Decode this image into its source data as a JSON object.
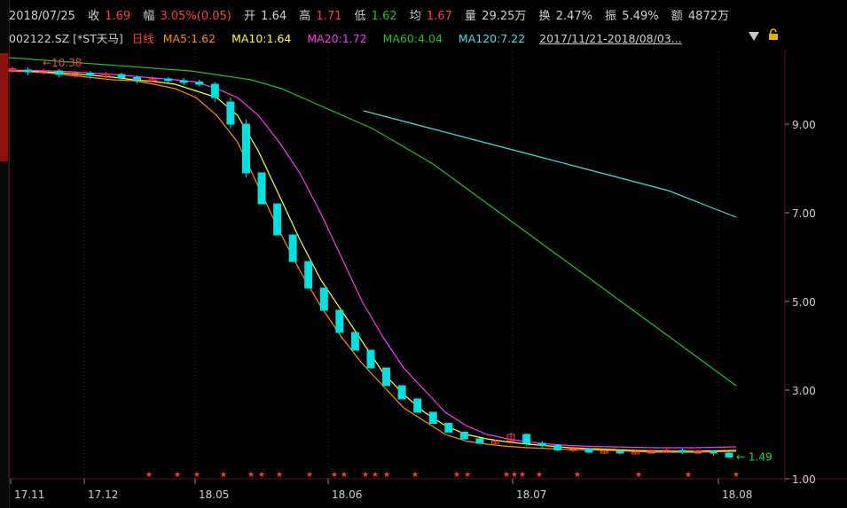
{
  "quote": {
    "date": "2018/07/25",
    "close_label": "收",
    "close": "1.69",
    "change_label": "幅",
    "change": "3.05%(0.05)",
    "open_label": "开",
    "open": "1.64",
    "high_label": "高",
    "high": "1.71",
    "low_label": "低",
    "low": "1.62",
    "avg_label": "均",
    "avg": "1.67",
    "volume_label": "量",
    "volume": "29.25万",
    "turnover_label": "换",
    "turnover": "2.47%",
    "amplitude_label": "振",
    "amplitude": "5.49%",
    "amount_label": "额",
    "amount": "4872万"
  },
  "indicators": {
    "code": "002122.SZ [*ST天马]",
    "period": "日线",
    "ma5": "MA5:1.62",
    "ma10": "MA10:1.64",
    "ma20": "MA20:1.72",
    "ma60": "MA60:4.04",
    "ma120": "MA120:7.22",
    "range": "2017/11/21-2018/08/03...",
    "dropdown_icon": "triangle-down-icon",
    "lock_icon": "unlock-icon"
  },
  "colors": {
    "up": "#ff3b3b",
    "down": "#00e0e0",
    "ma5": "#ff8c00",
    "ma10": "#ffff33",
    "ma20": "#ff33ff",
    "ma60": "#20c020",
    "ma120": "#40e0e0",
    "grid": "#6e0f0f"
  },
  "chart_data": {
    "type": "candlestick",
    "ylim": [
      1.0,
      10.7
    ],
    "y_ticks": [
      "9.00",
      "7.00",
      "5.00",
      "3.00",
      "1.00"
    ],
    "x_ticks": [
      "17.11",
      "17.12",
      "18.05",
      "18.06",
      "18.07",
      "18.08"
    ],
    "high_marker": "10.38",
    "last_marker": "1.49",
    "star_marker": "★",
    "ma5": [
      10.2,
      10.18,
      10.15,
      10.1,
      10.05,
      10.0,
      9.98,
      9.9,
      9.8,
      9.6,
      9.2,
      8.6,
      7.6,
      6.6,
      5.7,
      4.9,
      4.2,
      3.6,
      3.1,
      2.6,
      2.3,
      2.0,
      1.85,
      1.78,
      1.73,
      1.7,
      1.68,
      1.66,
      1.65,
      1.64,
      1.62,
      1.6,
      1.6,
      1.6,
      1.61,
      1.62
    ],
    "ma10": [
      10.2,
      10.19,
      10.17,
      10.14,
      10.1,
      10.06,
      10.0,
      9.96,
      9.9,
      9.75,
      9.6,
      9.2,
      8.4,
      7.4,
      6.4,
      5.5,
      4.8,
      4.1,
      3.4,
      2.9,
      2.5,
      2.2,
      2.0,
      1.9,
      1.83,
      1.78,
      1.74,
      1.7,
      1.68,
      1.66,
      1.64,
      1.63,
      1.62,
      1.62,
      1.63,
      1.64
    ],
    "ma20": [
      10.22,
      10.21,
      10.2,
      10.18,
      10.15,
      10.12,
      10.08,
      10.04,
      10.0,
      9.95,
      9.8,
      9.6,
      9.2,
      8.6,
      7.9,
      7.0,
      6.0,
      5.0,
      4.2,
      3.5,
      3.0,
      2.5,
      2.2,
      2.0,
      1.9,
      1.83,
      1.78,
      1.75,
      1.73,
      1.72,
      1.71,
      1.7,
      1.7,
      1.7,
      1.71,
      1.72
    ],
    "ma60": [
      10.5,
      10.45,
      10.4,
      10.35,
      10.3,
      10.25,
      10.2,
      10.1,
      10.0,
      9.8,
      9.5,
      9.2,
      8.9,
      8.5,
      8.1,
      7.6,
      7.1,
      6.6,
      6.1,
      5.6,
      5.1,
      4.6,
      4.1,
      3.6,
      3.1
    ],
    "ma120": [
      9.3,
      9.1,
      8.9,
      8.7,
      8.5,
      8.3,
      8.1,
      7.9,
      7.7,
      7.5,
      7.2,
      6.9
    ],
    "candles": [
      [
        10.2,
        10.25,
        10.15,
        10.3
      ],
      [
        10.22,
        10.18,
        10.1,
        10.28
      ],
      [
        10.18,
        10.2,
        10.12,
        10.26
      ],
      [
        10.2,
        10.12,
        10.05,
        10.24
      ],
      [
        10.12,
        10.15,
        10.05,
        10.2
      ],
      [
        10.15,
        10.1,
        10.02,
        10.2
      ],
      [
        10.1,
        10.12,
        10.04,
        10.18
      ],
      [
        10.12,
        10.05,
        9.98,
        10.16
      ],
      [
        10.05,
        10.0,
        9.92,
        10.1
      ],
      [
        10.0,
        10.02,
        9.95,
        10.08
      ],
      [
        10.02,
        9.98,
        9.9,
        10.06
      ],
      [
        9.98,
        9.95,
        9.88,
        10.04
      ],
      [
        9.95,
        9.9,
        9.85,
        10.0
      ],
      [
        9.9,
        9.6,
        9.5,
        9.95
      ],
      [
        9.5,
        9.0,
        8.9,
        9.6
      ],
      [
        9.0,
        7.9,
        7.8,
        9.1
      ],
      [
        7.9,
        7.2,
        7.2,
        7.9
      ],
      [
        7.2,
        6.5,
        6.5,
        7.2
      ],
      [
        6.5,
        5.9,
        5.9,
        6.5
      ],
      [
        5.9,
        5.3,
        5.3,
        5.9
      ],
      [
        5.3,
        4.8,
        4.8,
        5.3
      ],
      [
        4.8,
        4.3,
        4.3,
        4.8
      ],
      [
        4.3,
        3.9,
        3.9,
        4.3
      ],
      [
        3.9,
        3.5,
        3.5,
        3.9
      ],
      [
        3.5,
        3.1,
        3.1,
        3.5
      ],
      [
        3.1,
        2.8,
        2.8,
        3.1
      ],
      [
        2.8,
        2.5,
        2.5,
        2.8
      ],
      [
        2.5,
        2.25,
        2.25,
        2.5
      ],
      [
        2.25,
        2.05,
        2.05,
        2.25
      ],
      [
        2.05,
        1.9,
        1.9,
        2.05
      ],
      [
        1.9,
        1.8,
        1.78,
        1.92
      ],
      [
        1.8,
        1.85,
        1.75,
        1.88
      ],
      [
        1.85,
        2.0,
        1.8,
        2.05
      ],
      [
        2.0,
        1.8,
        1.75,
        2.02
      ],
      [
        1.8,
        1.75,
        1.7,
        1.85
      ],
      [
        1.75,
        1.65,
        1.62,
        1.78
      ],
      [
        1.65,
        1.68,
        1.6,
        1.72
      ],
      [
        1.68,
        1.6,
        1.58,
        1.7
      ],
      [
        1.6,
        1.62,
        1.56,
        1.66
      ],
      [
        1.62,
        1.58,
        1.55,
        1.65
      ],
      [
        1.58,
        1.6,
        1.55,
        1.64
      ],
      [
        1.6,
        1.62,
        1.56,
        1.66
      ],
      [
        1.62,
        1.64,
        1.58,
        1.7
      ],
      [
        1.64,
        1.6,
        1.56,
        1.68
      ],
      [
        1.6,
        1.62,
        1.55,
        1.66
      ],
      [
        1.62,
        1.58,
        1.52,
        1.65
      ],
      [
        1.58,
        1.49,
        1.47,
        1.6
      ]
    ]
  }
}
